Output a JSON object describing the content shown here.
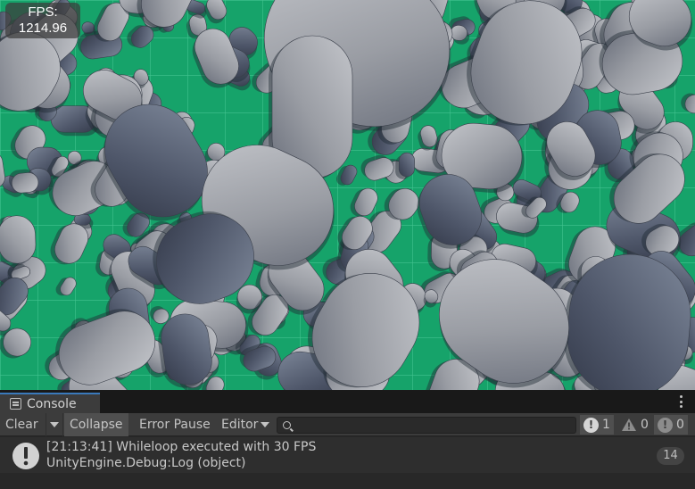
{
  "game_view": {
    "fps_label": "FPS:",
    "fps_value": "1214.96",
    "colors": {
      "floor": "#16a36a",
      "grid": "#5fd9a8",
      "capsule_light": "#a9acb2",
      "capsule_shadow": "#454b5c"
    }
  },
  "console": {
    "tab_label": "Console",
    "toolbar": {
      "clear_label": "Clear",
      "collapse_label": "Collapse",
      "error_pause_label": "Error Pause",
      "editor_label": "Editor",
      "search_placeholder": "",
      "info_count": "1",
      "warning_count": "0",
      "error_count": "0"
    },
    "entries": [
      {
        "line1": "[21:13:41] Whileloop executed with 30 FPS",
        "line2": "UnityEngine.Debug:Log (object)",
        "count": "14"
      }
    ]
  }
}
